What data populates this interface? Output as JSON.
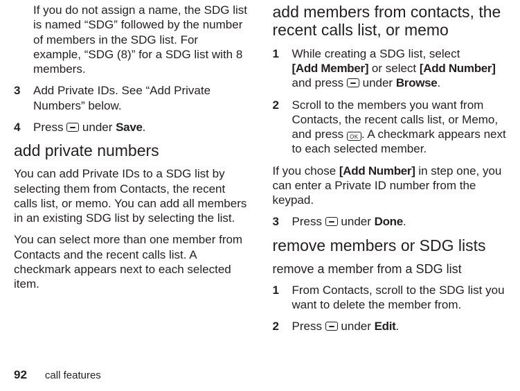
{
  "left": {
    "intro_autoname": "If you do not assign a name, the SDG list is named “SDG” followed by the number of members in the SDG list. For example, “SDG (8)” for a SDG list with 8 members.",
    "step3_num": "3",
    "step3_txt": "Add Private IDs. See “Add Private Numbers” below.",
    "step4_num": "4",
    "step4_a": "Press ",
    "step4_b": " under ",
    "step4_label": "Save",
    "step4_end": ".",
    "h_add_private": "add private numbers",
    "apn_p1": "You can add Private IDs to a SDG list by selecting them from Contacts, the recent calls list, or memo. You can add all members in an existing SDG list by selecting the list.",
    "apn_p2": "You can select more than one member from Contacts and the recent calls list. A checkmark appears next to each selected item."
  },
  "right": {
    "h_add_members": "add members from contacts, the recent calls list, or memo",
    "s1_num": "1",
    "s1_a": "While creating a SDG list, select ",
    "s1_addmember": "[Add Member]",
    "s1_b": " or select ",
    "s1_addnumber": "[Add Number]",
    "s1_c": " and press ",
    "s1_d": " under ",
    "s1_browse": "Browse",
    "s1_end": ".",
    "s2_num": "2",
    "s2_a": "Scroll to the members you want from Contacts, the recent calls list, or Memo, and press ",
    "s2_b": ". A checkmark appears next to each selected member.",
    "note_a": "If you chose ",
    "note_addnumber": "[Add Number]",
    "note_b": " in step one, you can enter a Private ID number from the keypad.",
    "s3_num": "3",
    "s3_a": "Press  ",
    "s3_b": " under ",
    "s3_done": "Done",
    "s3_end": ".",
    "h_remove": "remove members or SDG lists",
    "h_remove_member": "remove a member from a SDG list",
    "r1_num": "1",
    "r1_txt": "From Contacts, scroll to the SDG list you want to delete the member from.",
    "r2_num": "2",
    "r2_a": "Press ",
    "r2_b": " under ",
    "r2_edit": "Edit",
    "r2_end": "."
  },
  "footer": {
    "page_number": "92",
    "section": "call features"
  }
}
